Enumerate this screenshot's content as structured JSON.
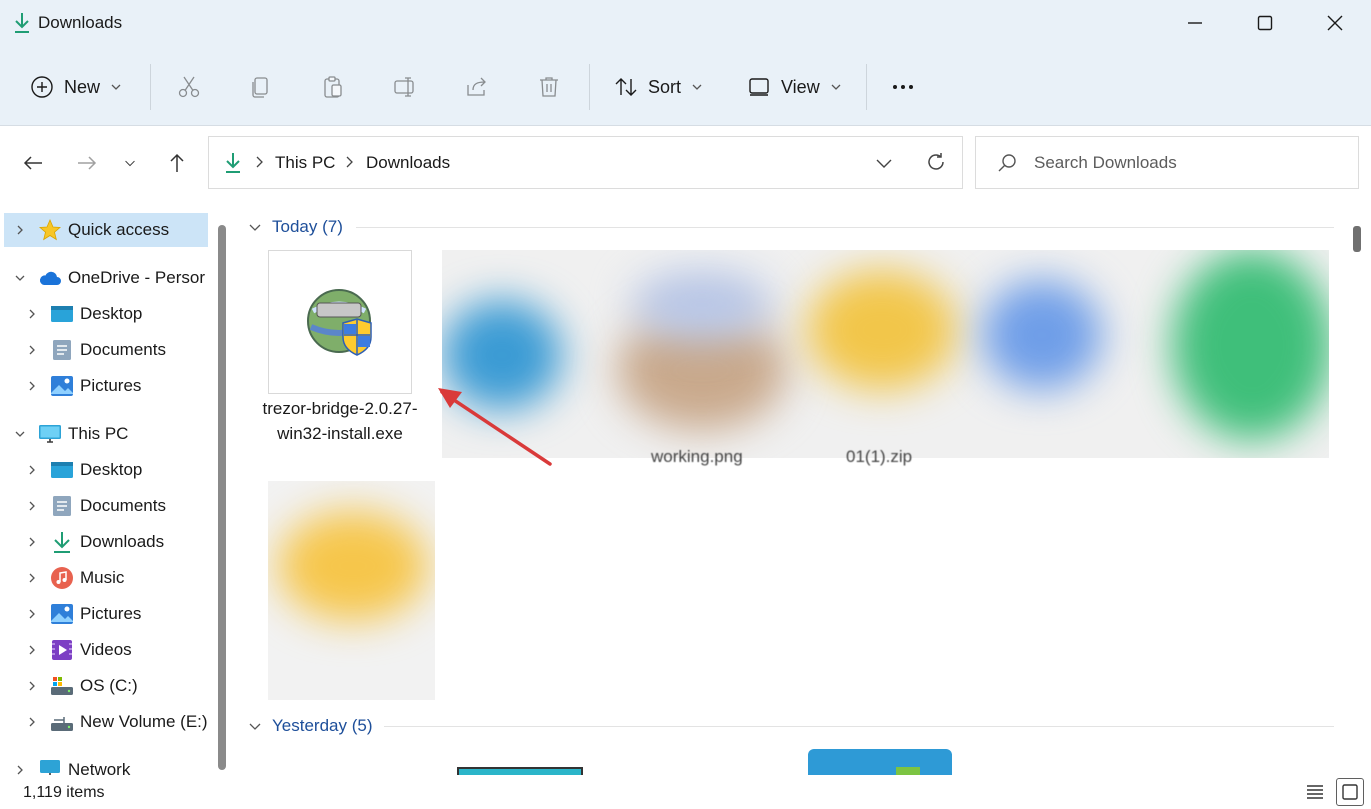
{
  "window": {
    "title": "Downloads",
    "minimize_icon": "minimize-icon",
    "maximize_icon": "maximize-icon",
    "close_icon": "close-icon"
  },
  "toolbar": {
    "new_label": "New",
    "sort_label": "Sort",
    "view_label": "View",
    "icons": [
      "cut-icon",
      "copy-icon",
      "paste-icon",
      "rename-icon",
      "share-icon",
      "delete-icon",
      "more-icon"
    ]
  },
  "address": {
    "crumbs": [
      "This PC",
      "Downloads"
    ]
  },
  "search": {
    "placeholder": "Search Downloads"
  },
  "sidebar": {
    "items": [
      {
        "label": "Quick access",
        "icon": "star-icon"
      },
      {
        "label": "OneDrive - Persor",
        "icon": "cloud-icon"
      },
      {
        "label": "Desktop",
        "icon": "desktop-folder-icon"
      },
      {
        "label": "Documents",
        "icon": "documents-icon"
      },
      {
        "label": "Pictures",
        "icon": "pictures-icon"
      },
      {
        "label": "This PC",
        "icon": "monitor-icon"
      },
      {
        "label": "Desktop",
        "icon": "desktop-folder-icon"
      },
      {
        "label": "Documents",
        "icon": "documents-icon"
      },
      {
        "label": "Downloads",
        "icon": "download-icon"
      },
      {
        "label": "Music",
        "icon": "music-icon"
      },
      {
        "label": "Pictures",
        "icon": "pictures-icon"
      },
      {
        "label": "Videos",
        "icon": "videos-icon"
      },
      {
        "label": "OS (C:)",
        "icon": "drive-icon"
      },
      {
        "label": "New Volume (E:)",
        "icon": "drive-icon"
      },
      {
        "label": "Network",
        "icon": "network-icon"
      }
    ]
  },
  "content": {
    "groups": [
      {
        "label": "Today",
        "count": "(7)"
      },
      {
        "label": "Yesterday",
        "count": "(5)"
      }
    ],
    "files": [
      {
        "name": "trezor-bridge-2.0.27-win32-install.exe",
        "icon": "installer-icon"
      }
    ],
    "partial_labels": [
      "working.png",
      "01(1).zip"
    ]
  },
  "status": {
    "item_count": "1,119 items"
  },
  "colors": {
    "accent": "#0067c0",
    "group_header": "#1e4f9a",
    "selection": "#cce4f7",
    "annotation_arrow": "#d93a3a"
  }
}
